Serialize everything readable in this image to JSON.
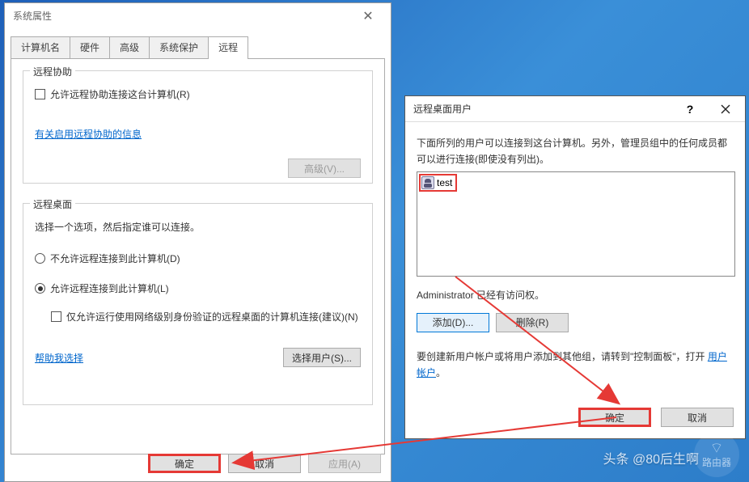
{
  "sysprops": {
    "title": "系统属性",
    "tabs": {
      "computer_name": "计算机名",
      "hardware": "硬件",
      "advanced": "高级",
      "protection": "系统保护",
      "remote": "远程"
    },
    "assist": {
      "legend": "远程协助",
      "allow_label": "允许远程协助连接这台计算机(R)",
      "info_link": "有关启用远程协助的信息",
      "advanced_btn": "高级(V)..."
    },
    "desktop": {
      "legend": "远程桌面",
      "hint": "选择一个选项，然后指定谁可以连接。",
      "deny_label": "不允许远程连接到此计算机(D)",
      "allow_label": "允许远程连接到此计算机(L)",
      "nla_label": "仅允许运行使用网络级别身份验证的远程桌面的计算机连接(建议)(N)",
      "help_link": "帮助我选择",
      "select_users_btn": "选择用户(S)..."
    },
    "buttons": {
      "ok": "确定",
      "cancel": "取消",
      "apply": "应用(A)"
    }
  },
  "rdu": {
    "title": "远程桌面用户",
    "desc": "下面所列的用户可以连接到这台计算机。另外，管理员组中的任何成员都可以进行连接(即使没有列出)。",
    "users": [
      "test"
    ],
    "admin_note": "Administrator 已经有访问权。",
    "add_btn": "添加(D)...",
    "remove_btn": "删除(R)",
    "create_note_prefix": "要创建新用户帐户或将用户添加到其他组，请转到\"控制面板\"，打开 ",
    "create_note_link": "用户帐户",
    "create_note_suffix": "。",
    "ok": "确定",
    "cancel": "取消"
  },
  "watermark": {
    "text": "头条 @80后生啊",
    "badge_line1": "路由器"
  }
}
